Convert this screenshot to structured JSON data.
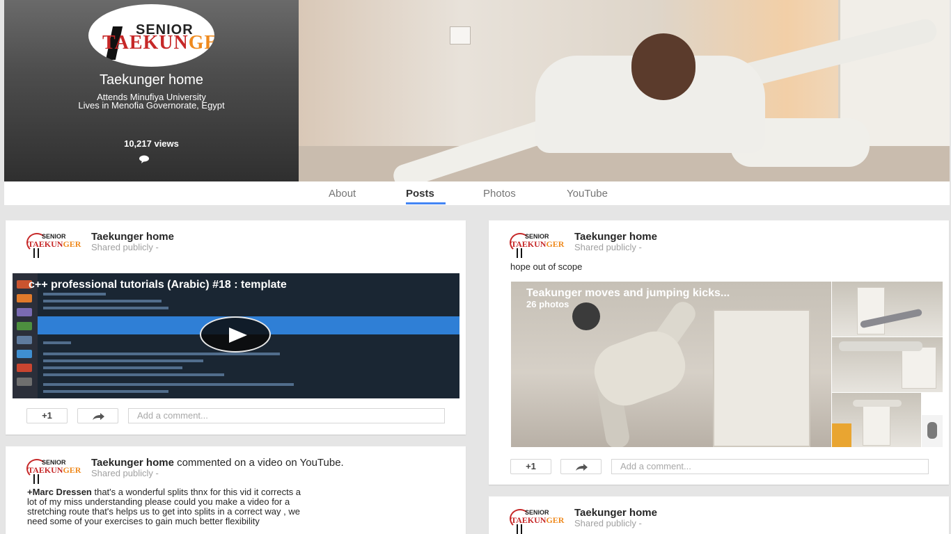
{
  "profile": {
    "name": "Taekunger home",
    "attends": "Attends Minufiya University",
    "lives": "Lives in Menofia Governorate, Egypt",
    "views": "10,217 views",
    "logo_senior": "SENIOR",
    "logo_main_red": "TAEKUN",
    "logo_main_orange": "GER"
  },
  "tabs": [
    {
      "label": "About"
    },
    {
      "label": "Posts",
      "active": true
    },
    {
      "label": "Photos"
    },
    {
      "label": "YouTube"
    }
  ],
  "posts": {
    "video_post": {
      "author": "Taekunger home",
      "shared": "Shared publicly  -",
      "video_title": "c++ professional tutorials (Arabic) #18 : template",
      "plus_one": "+1",
      "comment_placeholder": "Add a comment..."
    },
    "comment_post": {
      "author": "Taekunger home",
      "action": "commented on a video on YouTube.",
      "shared": "Shared publicly  -",
      "mention": "+Marc Dressen",
      "text_line1": " that's a wonderful splits thnx for this vid it corrects a",
      "text_line2": "lot of my miss understanding please could you make a video for a",
      "text_line3": "stretching route that's helps us to get into splits in a correct way , we",
      "text_line4": "need some of your exercises to gain much better flexibility"
    },
    "album_post": {
      "author": "Taekunger home",
      "shared": "Shared publicly  -",
      "text": "hope out of scope",
      "album_title": "Teakunger moves and jumping kicks...",
      "album_count": "26 photos",
      "plus_one": "+1",
      "comment_placeholder": "Add a comment..."
    },
    "bottom_post": {
      "author": "Taekunger home",
      "shared": "Shared publicly  -"
    }
  },
  "colors": {
    "accent_tab": "#4285f4",
    "logo_red": "#c62828",
    "logo_orange": "#ef8a1e"
  }
}
